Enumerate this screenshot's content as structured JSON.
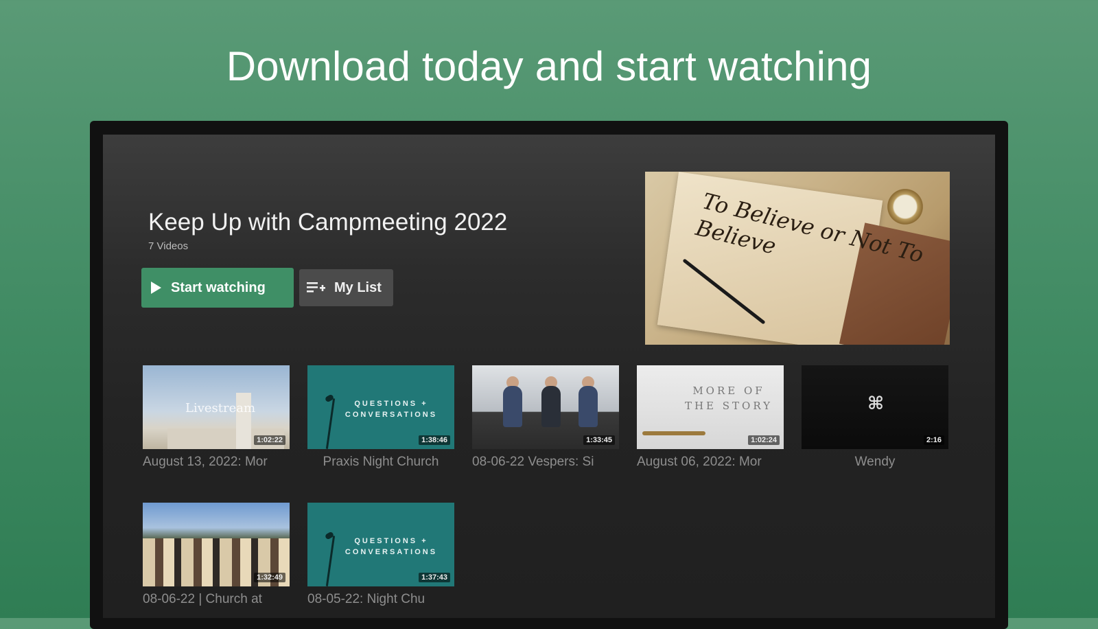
{
  "headline": "Download today and start watching",
  "hero": {
    "title": "Keep Up with Campmeeting 2022",
    "subtitle": "7 Videos",
    "start_label": "Start watching",
    "mylist_label": "My List",
    "art_text": "To Believe or Not To Believe"
  },
  "videos": [
    {
      "label": "August 13, 2022: Mor",
      "duration": "1:02:22",
      "thumb_text": "Livestream"
    },
    {
      "label": "Praxis Night Church",
      "duration": "1:38:46",
      "thumb_text": "QUESTIONS + CONVERSATIONS"
    },
    {
      "label": "08-06-22 Vespers: Si",
      "duration": "1:33:45",
      "thumb_text": ""
    },
    {
      "label": "August 06, 2022: Mor",
      "duration": "1:02:24",
      "thumb_text": "MORE OF THE STORY"
    },
    {
      "label": "Wendy",
      "duration": "2:16",
      "thumb_text": ""
    },
    {
      "label": "08-06-22 | Church at",
      "duration": "1:32:49",
      "thumb_text": ""
    },
    {
      "label": "08-05-22: Night Chu",
      "duration": "1:37:43",
      "thumb_text": "QUESTIONS + CONVERSATIONS"
    }
  ],
  "icons": {
    "play": "play-icon",
    "mylist": "playlist-add-icon"
  },
  "colors": {
    "background": "#3f8a62",
    "primary_button": "#3f8f66",
    "secondary_button": "#4b4b4b",
    "screen": "#262626"
  }
}
